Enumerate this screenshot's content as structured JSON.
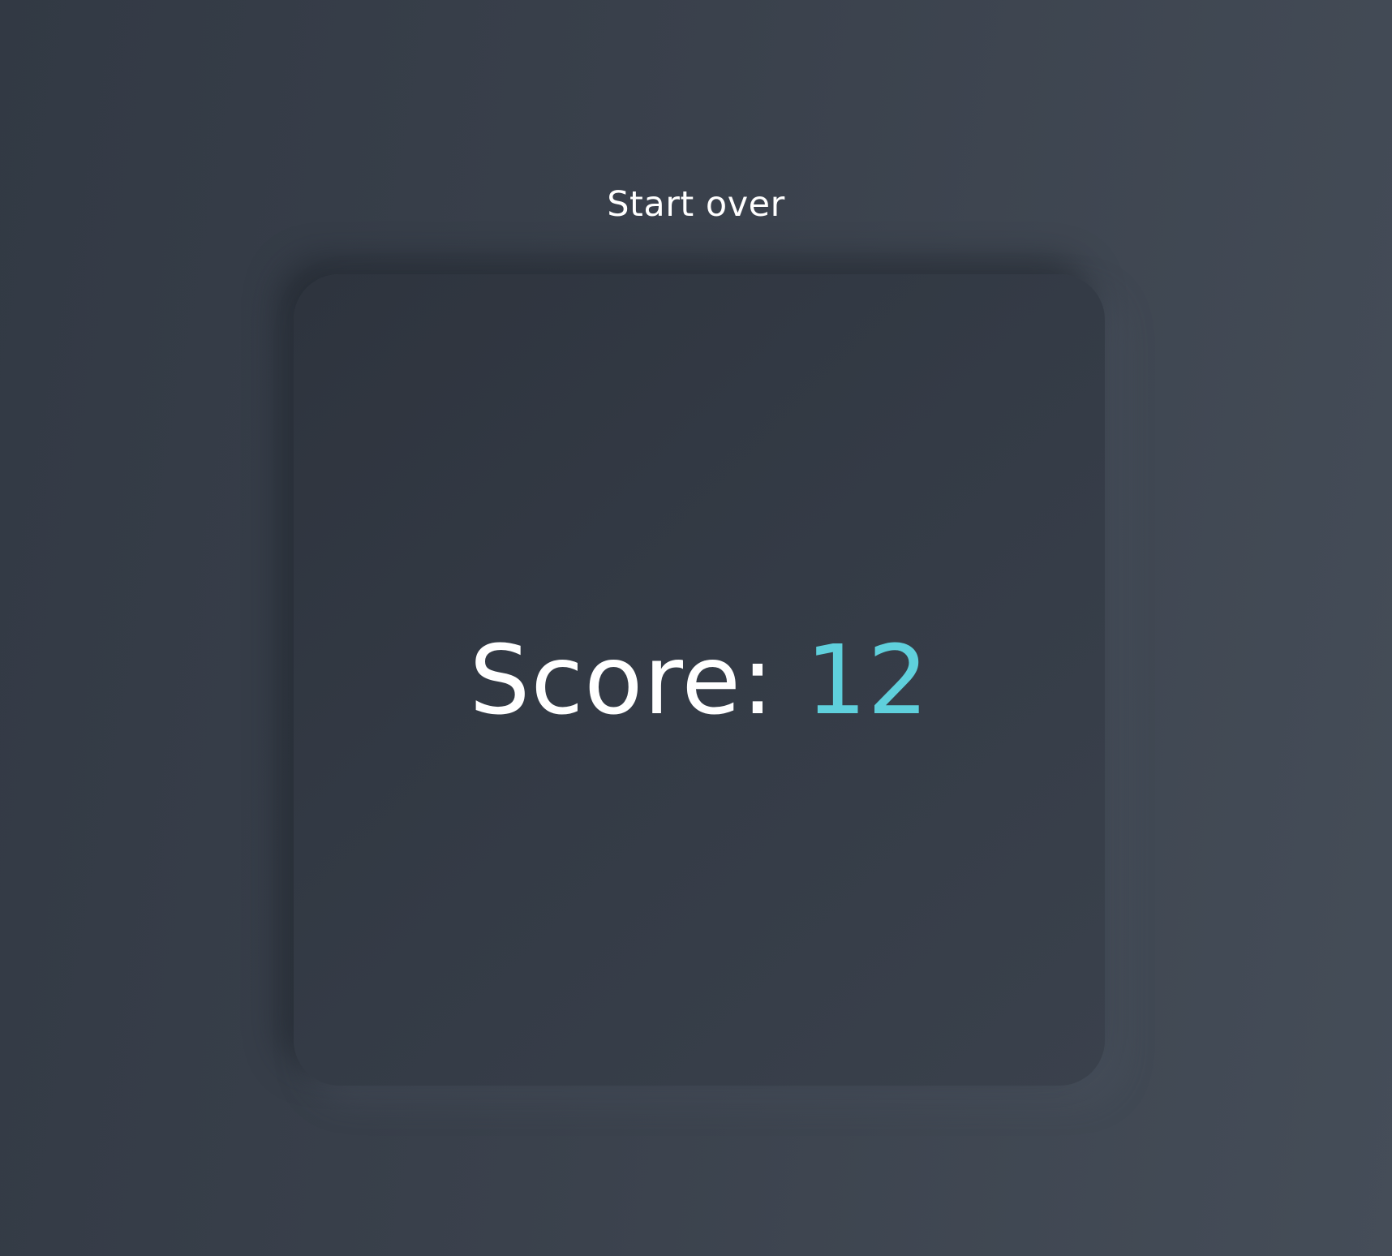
{
  "controls": {
    "start_over_label": "Start over"
  },
  "result": {
    "score_label": "Score:",
    "score_value": "12"
  },
  "colors": {
    "score_accent": "#5fd0dc",
    "text": "#ffffff",
    "background": "#3a414c"
  }
}
